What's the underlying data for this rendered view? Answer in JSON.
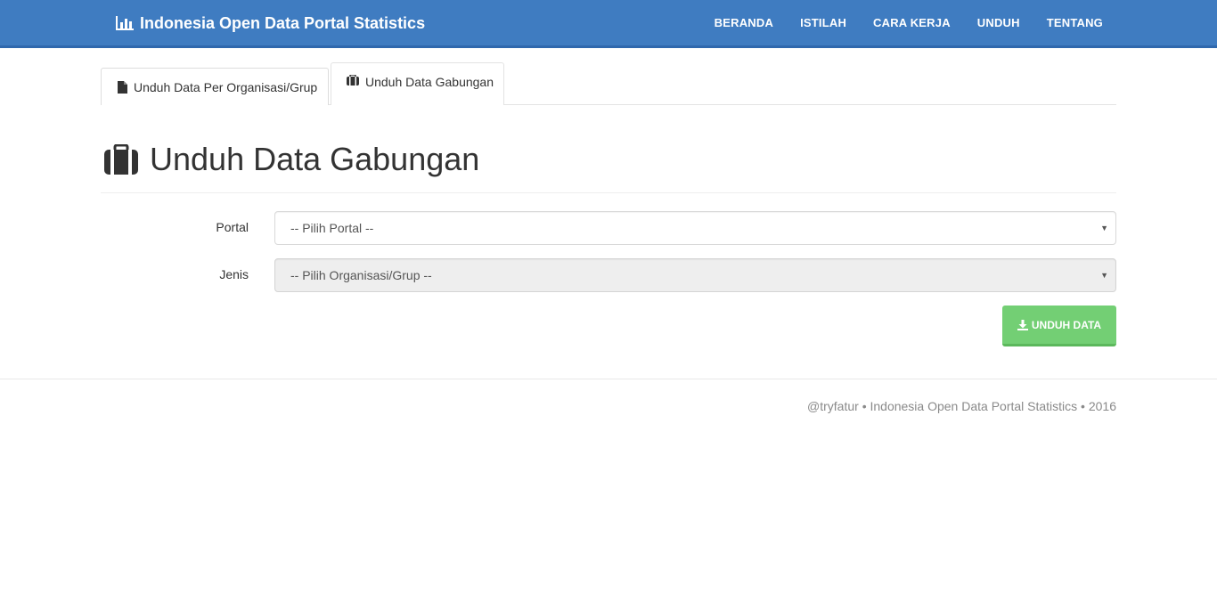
{
  "navbar": {
    "brand": "Indonesia Open Data Portal Statistics",
    "brand_icon": "bar-chart-icon",
    "links": [
      "BERANDA",
      "ISTILAH",
      "CARA KERJA",
      "UNDUH",
      "TENTANG"
    ]
  },
  "tabs": [
    {
      "label": "Unduh Data Per Organisasi/Grup",
      "icon": "file-icon",
      "active": false
    },
    {
      "label": "Unduh Data Gabungan",
      "icon": "briefcase-icon",
      "active": true
    }
  ],
  "page": {
    "title": "Unduh Data Gabungan",
    "title_icon": "briefcase-icon"
  },
  "form": {
    "portal_label": "Portal",
    "portal_value": "-- Pilih Portal --",
    "jenis_label": "Jenis",
    "jenis_value": "-- Pilih Organisasi/Grup --",
    "submit_label": "UNDUH DATA"
  },
  "footer": {
    "text": "@tryfatur • Indonesia Open Data Portal Statistics • 2016"
  },
  "colors": {
    "navbar": "#3f7cc1",
    "button": "#73cf74"
  }
}
